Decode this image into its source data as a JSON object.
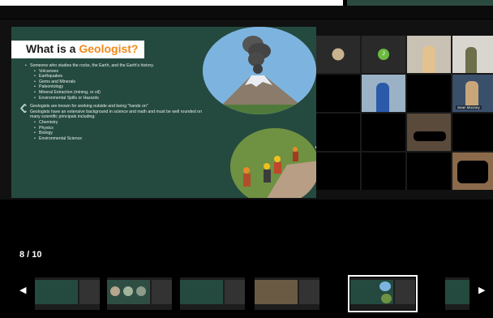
{
  "slide": {
    "title_part1": "What is a ",
    "title_part2": "Geologist?",
    "bullets": [
      {
        "level": 1,
        "text": "Someone who studies the  rocks, the Earth, and the Earth's history."
      },
      {
        "level": 2,
        "text": "Volcanoes"
      },
      {
        "level": 2,
        "text": "Earthquakes"
      },
      {
        "level": 2,
        "text": "Gems and Minerals"
      },
      {
        "level": 2,
        "text": "Paleontology"
      },
      {
        "level": 2,
        "text": "Mineral Extraction (mining, or oil)"
      },
      {
        "level": 2,
        "text": "Environmental Spills or Hazards"
      },
      {
        "level": 0,
        "text": ""
      },
      {
        "level": 1,
        "text": "Geologists are known for working outside and being \"hands on\""
      },
      {
        "level": 1,
        "text": "Geologists have an extensive background in science and math and must be well rounded on many scientific principals including:"
      },
      {
        "level": 2,
        "text": "Chemistry"
      },
      {
        "level": 2,
        "text": "Physics"
      },
      {
        "level": 2,
        "text": "Biology"
      },
      {
        "level": 2,
        "text": "Environmental Science"
      }
    ]
  },
  "video_tiles": {
    "initial_j": "J",
    "name_sean": "Sean Mooney"
  },
  "pager": {
    "counter": "8 / 10",
    "prev_icon": "left-arrow-icon",
    "next_icon": "right-arrow-icon",
    "prev_glyph": "◀",
    "next_glyph": "▶",
    "thumbnail_count": 6,
    "active_index": 4
  },
  "colors": {
    "slide_bg": "#244a3f",
    "title_accent": "#f08a1b",
    "avatar_green": "#6cba3f"
  }
}
